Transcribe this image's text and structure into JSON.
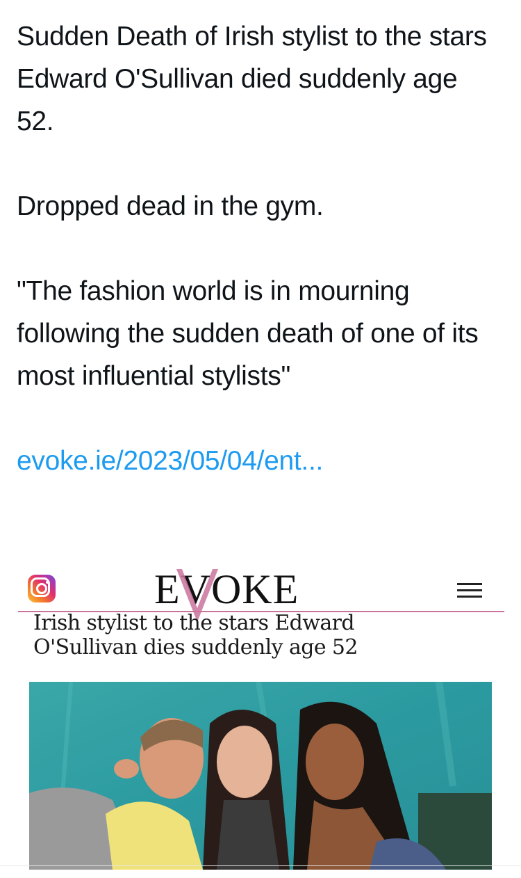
{
  "tweet": {
    "line1": "Sudden Death of Irish stylist to the stars",
    "line2": "Edward O'Sullivan died suddenly age 52.",
    "line3": "Dropped dead in the gym.",
    "line4": "\"The fashion world is in mourning following the sudden death of one of its most influential stylists\"",
    "link_text": "evoke.ie/2023/05/04/ent..."
  },
  "card": {
    "social_icon": "instagram-icon",
    "logo_text": "EVOKE",
    "menu_icon": "hamburger-menu-icon",
    "headline": "Irish stylist to the stars Edward O'Sullivan dies suddenly age 52",
    "accent_color": "#c9739b",
    "link_color": "#1d9bf0"
  }
}
